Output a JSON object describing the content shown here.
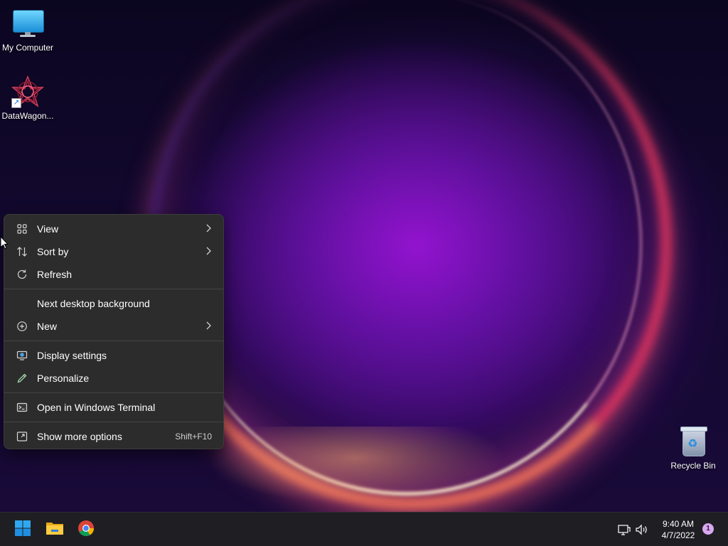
{
  "desktop": {
    "icons": [
      {
        "label": "My Computer",
        "icon": "monitor-icon"
      },
      {
        "label": "DataWagon...",
        "icon": "datawagon-app-icon"
      },
      {
        "label": "Recycle Bin",
        "icon": "recycle-bin-icon"
      }
    ]
  },
  "context_menu": {
    "items": [
      {
        "label": "View",
        "icon": "grid-view-icon",
        "submenu": true
      },
      {
        "label": "Sort by",
        "icon": "sort-icon",
        "submenu": true
      },
      {
        "label": "Refresh",
        "icon": "refresh-icon"
      },
      {
        "label": "Next desktop background"
      },
      {
        "label": "New",
        "icon": "plus-circle-icon",
        "submenu": true
      },
      {
        "label": "Display settings",
        "icon": "display-settings-icon"
      },
      {
        "label": "Personalize",
        "icon": "pen-icon"
      },
      {
        "label": "Open in Windows Terminal",
        "icon": "terminal-icon"
      },
      {
        "label": "Show more options",
        "icon": "show-more-icon",
        "shortcut": "Shift+F10"
      }
    ]
  },
  "taskbar": {
    "apps": [
      {
        "name": "start",
        "icon": "windows-logo-icon"
      },
      {
        "name": "file-explorer",
        "icon": "folder-icon"
      },
      {
        "name": "chrome",
        "icon": "chrome-icon"
      }
    ],
    "tray": {
      "icons": [
        "network-icon",
        "volume-icon"
      ],
      "time": "9:40 AM",
      "date": "4/7/2022",
      "notification_count": "1"
    }
  },
  "colors": {
    "menu_bg": "#2c2c2c",
    "taskbar_bg": "#1f1f23",
    "accent": "#0078d4"
  }
}
